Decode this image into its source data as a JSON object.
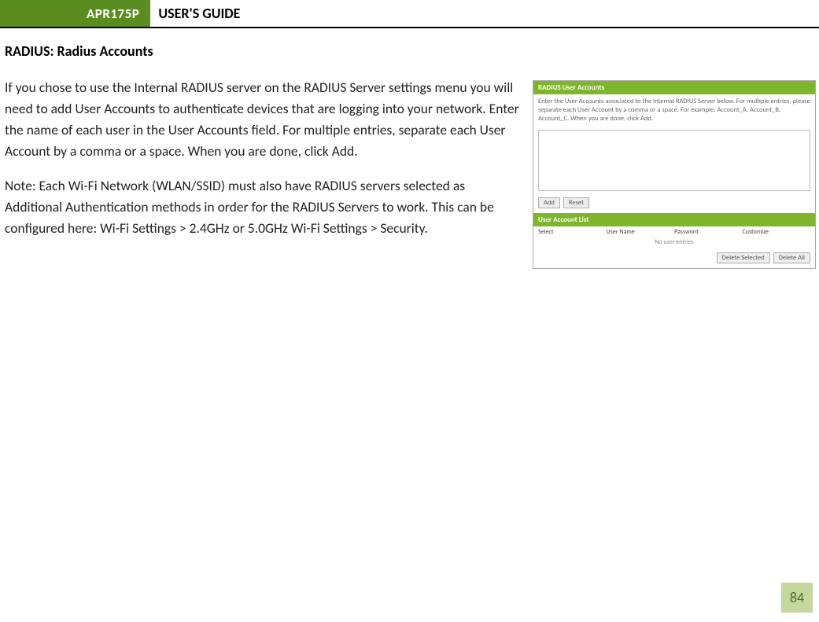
{
  "header": {
    "badge": "APR175P",
    "title": "USER'S GUIDE"
  },
  "section_title": "RADIUS: Radius Accounts",
  "paragraphs": {
    "p1": "If you chose to use the Internal RADIUS server on the RADIUS Server settings menu you will need to add User Accounts to authenticate devices that are logging into your network.  Enter the name of each user in the User Accounts field.  For multiple entries, separate each User Account by a comma or a space.  When you are done, click Add.",
    "p2": "Note: Each Wi-Fi Network (WLAN/SSID) must also have RADIUS servers selected as Additional Authentication methods in order for the RADIUS Servers to work.  This can be configured here: Wi-Fi Settings > 2.4GHz or 5.0GHz Wi-Fi Settings > Security."
  },
  "figure": {
    "bar1_title": "RADIUS User Accounts",
    "desc": "Enter the User Accounts associated to the Internal RADIUS Server below. For multiple entries, please separate each User Account by a comma or a space. For example: Account_A, Account_B, Account_C. When you are done, click Add.",
    "btn_add": "Add",
    "btn_reset": "Reset",
    "bar2_title": "User Account List",
    "col_select": "Select",
    "col_user": "User Name",
    "col_pass": "Password",
    "col_custom": "Customize",
    "empty": "No user entries",
    "btn_delete_selected": "Delete Selected",
    "btn_delete_all": "Delete All"
  },
  "page_number": "84"
}
